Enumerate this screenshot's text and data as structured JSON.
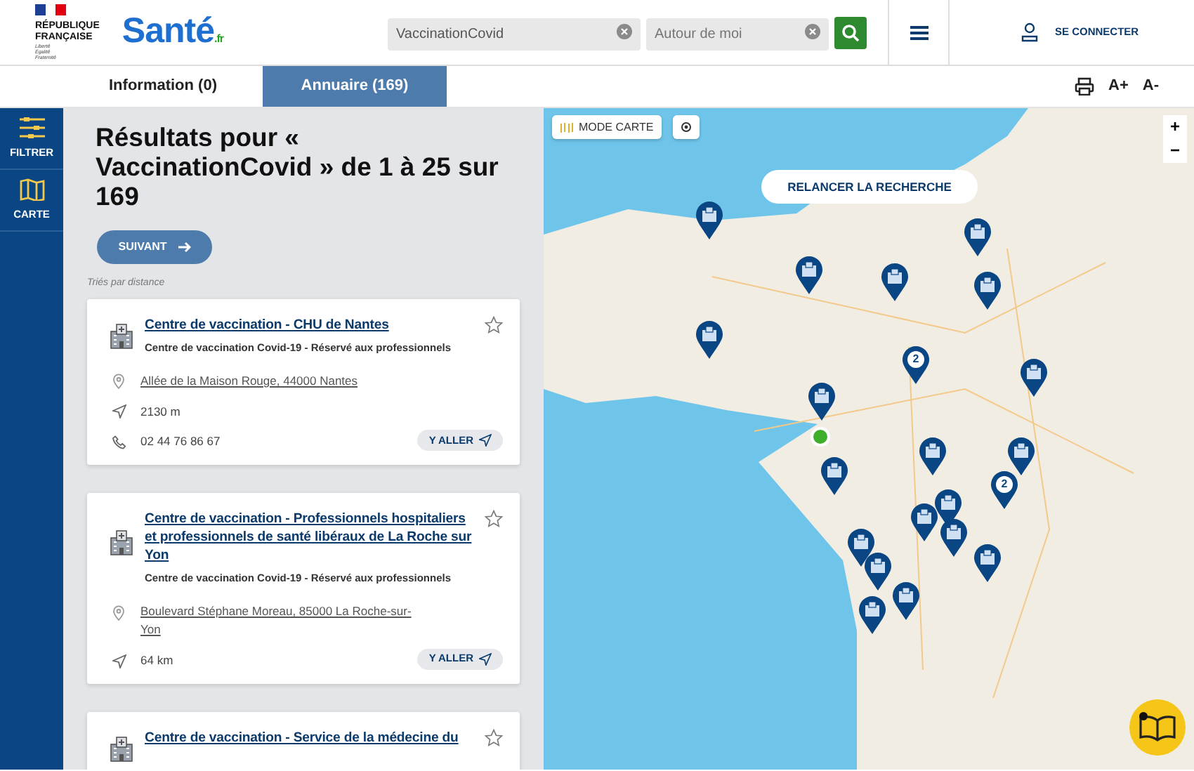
{
  "header": {
    "gov_logo": [
      "RÉPUBLIQUE",
      "FRANÇAISE"
    ],
    "gov_motto": [
      "Liberté",
      "Égalité",
      "Fraternité"
    ],
    "brand": "Santé",
    "brand_suffix": ".fr",
    "search": {
      "value": "VaccinationCovid"
    },
    "location": {
      "placeholder": "Autour de moi"
    },
    "login": "SE CONNECTER"
  },
  "tabs": [
    {
      "label": "Information (0)",
      "selected": false
    },
    {
      "label": "Annuaire (169)",
      "selected": true
    }
  ],
  "text_tools": [
    "A+",
    "A-"
  ],
  "sidebar": {
    "items": [
      {
        "kind": "filter",
        "label": "FILTRER"
      },
      {
        "kind": "map",
        "label": "CARTE"
      }
    ]
  },
  "results": {
    "title": "Résultats pour « VaccinationCovid » de 1 à 25 sur 169",
    "next_button": "SUIVANT",
    "sort_note": "Triés par distance",
    "cards": [
      {
        "title": "Centre de vaccination - CHU de Nantes",
        "subtitle": "Centre de vaccination Covid-19 - Réservé aux professionnels",
        "favorite": false,
        "details": [
          {
            "kind": "address",
            "text": "Allée de la Maison Rouge, 44000 Nantes"
          },
          {
            "kind": "distance",
            "text": "2130 m"
          },
          {
            "kind": "phone",
            "text": "02 44 76 86 67"
          }
        ],
        "go_button": "Y ALLER"
      },
      {
        "title": "Centre de vaccination - Professionnels hospitaliers et professionnels de santé libéraux de La Roche sur Yon",
        "subtitle": "Centre de vaccination Covid-19 - Réservé aux professionnels",
        "favorite": false,
        "details": [
          {
            "kind": "address",
            "text": "Boulevard Stéphane Moreau, 85000 La Roche-sur-Yon"
          },
          {
            "kind": "distance",
            "text": "64 km"
          }
        ],
        "go_button": "Y ALLER"
      },
      {
        "title": "Centre de vaccination - Service de la médecine du",
        "favorite": false
      }
    ]
  },
  "map": {
    "mode_button": "MODE CARTE",
    "relaunch_button": "RELANCER LA RECHERCHE",
    "zoom_in": "+",
    "zoom_out": "−",
    "markers": [
      {
        "kind": "pin"
      },
      {
        "kind": "pin"
      },
      {
        "kind": "pin"
      },
      {
        "kind": "pin"
      },
      {
        "kind": "pin"
      },
      {
        "kind": "pin"
      },
      {
        "kind": "cluster",
        "count": "2"
      },
      {
        "kind": "pin"
      },
      {
        "kind": "pin"
      },
      {
        "kind": "pin"
      },
      {
        "kind": "pin"
      },
      {
        "kind": "pin"
      },
      {
        "kind": "cluster",
        "count": "2"
      },
      {
        "kind": "pin"
      },
      {
        "kind": "pin"
      },
      {
        "kind": "pin"
      },
      {
        "kind": "pin"
      },
      {
        "kind": "pin"
      },
      {
        "kind": "pin"
      },
      {
        "kind": "pin"
      },
      {
        "kind": "pin"
      },
      {
        "kind": "position"
      }
    ]
  }
}
